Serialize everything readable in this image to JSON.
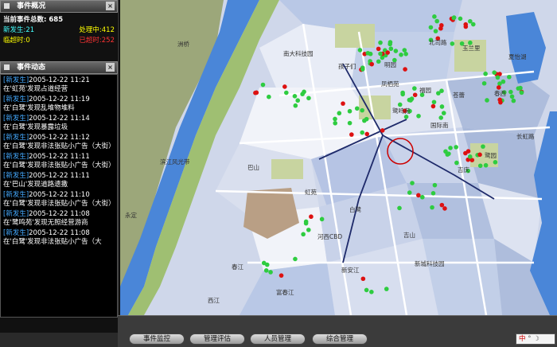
{
  "overview": {
    "title": "事件概况",
    "total_label": "当前事件总数:",
    "total_value": "685",
    "new_label": "新发生:",
    "new_value": "21",
    "processing_label": "处理中:",
    "processing_value": "412",
    "near_label": "临超时:",
    "near_value": "0",
    "overdue_label": "已超时:",
    "overdue_value": "252"
  },
  "dynamics": {
    "title": "事件动态",
    "events": [
      {
        "tag": "[新发生]",
        "time": "2005-12-22 11:21",
        "text": "在'虹苑'发现占道经营"
      },
      {
        "tag": "[新发生]",
        "time": "2005-12-22 11:19",
        "text": "在'白鹭'发现乱堆物堆料"
      },
      {
        "tag": "[新发生]",
        "time": "2005-12-22 11:14",
        "text": "在'白鹭'发现暴露垃圾"
      },
      {
        "tag": "[新发生]",
        "time": "2005-12-22 11:12",
        "text": "在'白鹭'发现非法张贴小广告（大街）"
      },
      {
        "tag": "[新发生]",
        "time": "2005-12-22 11:11",
        "text": "在'白鹭'发现非法张贴小广告（大街）"
      },
      {
        "tag": "[新发生]",
        "time": "2005-12-22 11:11",
        "text": "在'巴山'发现道路遗撒"
      },
      {
        "tag": "[新发生]",
        "time": "2005-12-22 11:10",
        "text": "在'白鹭'发现非法张贴小广告（大街）"
      },
      {
        "tag": "[新发生]",
        "time": "2005-12-22 11:08",
        "text": "在'鹭鸣苑'发现无照经营游商"
      },
      {
        "tag": "[新发生]",
        "time": "2005-12-22 11:08",
        "text": "在'白鹭'发现非法张贴小广告（大"
      }
    ]
  },
  "map_labels": [
    {
      "id": "l1",
      "text": "南大科技园"
    },
    {
      "id": "l2",
      "text": "北司路"
    },
    {
      "id": "l3",
      "text": "玉兰里"
    },
    {
      "id": "l4",
      "text": "夏怡湖"
    },
    {
      "id": "l5",
      "text": "明园"
    },
    {
      "id": "l6",
      "text": "孩子们"
    },
    {
      "id": "l7",
      "text": "凤栖苑"
    },
    {
      "id": "l8",
      "text": "福园"
    },
    {
      "id": "l9",
      "text": "苍蕾"
    },
    {
      "id": "l10",
      "text": "春西"
    },
    {
      "id": "l11",
      "text": "鹭鸣苑"
    },
    {
      "id": "l12",
      "text": "国际南"
    },
    {
      "id": "l13",
      "text": "长虹路"
    },
    {
      "id": "l14",
      "text": "滨江风光带"
    },
    {
      "id": "l15",
      "text": "鹭园"
    },
    {
      "id": "l16",
      "text": "吉庆"
    },
    {
      "id": "l17",
      "text": "巴山"
    },
    {
      "id": "l18",
      "text": "虹苑"
    },
    {
      "id": "l19",
      "text": "白鹭"
    },
    {
      "id": "l20",
      "text": "永定"
    },
    {
      "id": "l21",
      "text": "河西CBD"
    },
    {
      "id": "l22",
      "text": "新城科技园"
    },
    {
      "id": "l23",
      "text": "吉山"
    },
    {
      "id": "l24",
      "text": "新安江"
    },
    {
      "id": "l25",
      "text": "春江"
    },
    {
      "id": "l26",
      "text": "富春江"
    },
    {
      "id": "l27",
      "text": "西江"
    },
    {
      "id": "l28",
      "text": "洲桥"
    }
  ],
  "tabs": {
    "monitor": "事件监控",
    "evaluation": "管理评估",
    "personnel": "人员管理",
    "general": "综合管理"
  },
  "ime": {
    "label": "中",
    "icons": "° ☽"
  },
  "colors": {
    "new_event": "#2ecc40",
    "overdue_event": "#dd1111",
    "river": "#4a86d8",
    "park": "#c8d4a0"
  }
}
